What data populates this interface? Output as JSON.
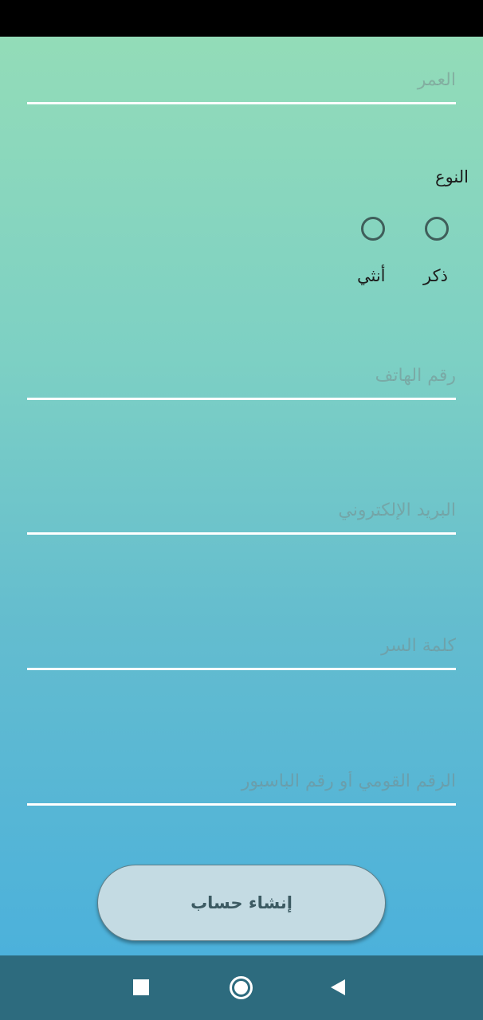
{
  "form": {
    "age": {
      "placeholder": "العمر",
      "value": ""
    },
    "gender": {
      "label": "النوع",
      "options": [
        {
          "label": "ذكر",
          "selected": false
        },
        {
          "label": "أنثي",
          "selected": false
        }
      ]
    },
    "phone": {
      "placeholder": "رقم الهاتف",
      "value": ""
    },
    "email": {
      "placeholder": "البريد الإلكتروني",
      "value": ""
    },
    "password": {
      "placeholder": "كلمة السر",
      "value": ""
    },
    "national_id": {
      "placeholder": "الرقم القومي أو رقم الباسبور",
      "value": ""
    }
  },
  "actions": {
    "create_account_label": "إنشاء حساب"
  },
  "navigation": {
    "recents_icon": "square-icon",
    "home_icon": "circle-icon",
    "back_icon": "triangle-back-icon"
  },
  "colors": {
    "gradient_top": "#93dcb8",
    "gradient_bottom": "#4cb1db",
    "button_bg": "#c4dbe3",
    "nav_bar": "#2d6b7e"
  }
}
